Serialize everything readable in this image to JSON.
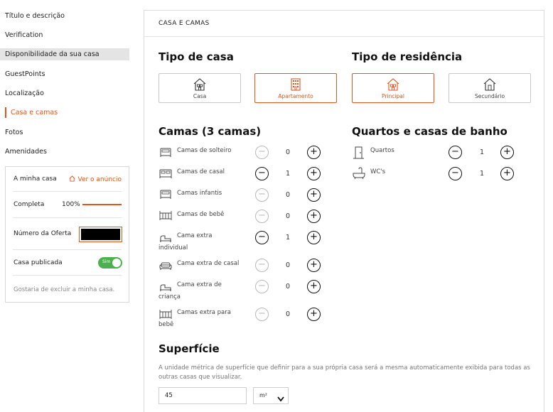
{
  "sidebar": {
    "items": [
      {
        "label": "Título e descrição"
      },
      {
        "label": "Verification"
      },
      {
        "label": "Disponibilidade da sua casa"
      },
      {
        "label": "GuestPoints"
      },
      {
        "label": "Localização"
      },
      {
        "label": "Casa e camas"
      },
      {
        "label": "Fotos"
      },
      {
        "label": "Amenidades"
      }
    ],
    "house_card": {
      "title": "A minha casa",
      "view_link": "Ver o anúncio",
      "complete_label": "Completa",
      "complete_value": "100%",
      "complete_fraction": 1.0,
      "offer_label": "Número da Oferta",
      "published_label": "Casa publicada",
      "toggle_label": "Sim",
      "delete_link": "Gostaria de excluir a minha casa."
    }
  },
  "main": {
    "header": "CASA E CAMAS",
    "house_type": {
      "title": "Tipo de casa",
      "options": [
        {
          "label": "Casa",
          "icon": "house-icon",
          "selected": false
        },
        {
          "label": "Apartamento",
          "icon": "apartment-icon",
          "selected": true
        }
      ]
    },
    "residence_type": {
      "title": "Tipo de residência",
      "options": [
        {
          "label": "Principal",
          "icon": "house-icon",
          "selected": true
        },
        {
          "label": "Secundário",
          "icon": "house-icon",
          "selected": false
        }
      ]
    },
    "beds": {
      "title": "Camas (3 camas)",
      "rows": [
        {
          "label1": "Camas de solteiro",
          "label2": "",
          "value": "0",
          "icon": "single-bed-icon"
        },
        {
          "label1": "Camas de casal",
          "label2": "",
          "value": "1",
          "icon": "double-bed-icon"
        },
        {
          "label1": "Camas infantis",
          "label2": "",
          "value": "0",
          "icon": "child-bed-icon"
        },
        {
          "label1": "Camas de bebê",
          "label2": "",
          "value": "0",
          "icon": "crib-icon"
        },
        {
          "label1": "Cama extra",
          "label2": "individual",
          "value": "1",
          "icon": "extra-bed-icon"
        },
        {
          "label1": "Cama extra de casal",
          "label2": "",
          "value": "0",
          "icon": "sofa-bed-icon"
        },
        {
          "label1": "Cama extra de",
          "label2": "criança",
          "value": "0",
          "icon": "extra-bed-icon"
        },
        {
          "label1": "Camas extra para",
          "label2": "bebê",
          "value": "0",
          "icon": "crib-icon"
        }
      ]
    },
    "rooms": {
      "title": "Quartos e casas de banho",
      "rows": [
        {
          "label": "Quartos",
          "value": "1",
          "icon": "door-icon"
        },
        {
          "label": "WC's",
          "value": "1",
          "icon": "bathtub-icon"
        }
      ]
    },
    "surface": {
      "title": "Superfície",
      "description": "A unidade métrica de superfície que definir para a sua própria casa será a mesma automaticamente exibida para todas as outras casas que visualizar.",
      "value": "45",
      "unit": "m²"
    },
    "colors": {
      "accent": "#e0561c",
      "toggle": "#4caf50"
    }
  }
}
